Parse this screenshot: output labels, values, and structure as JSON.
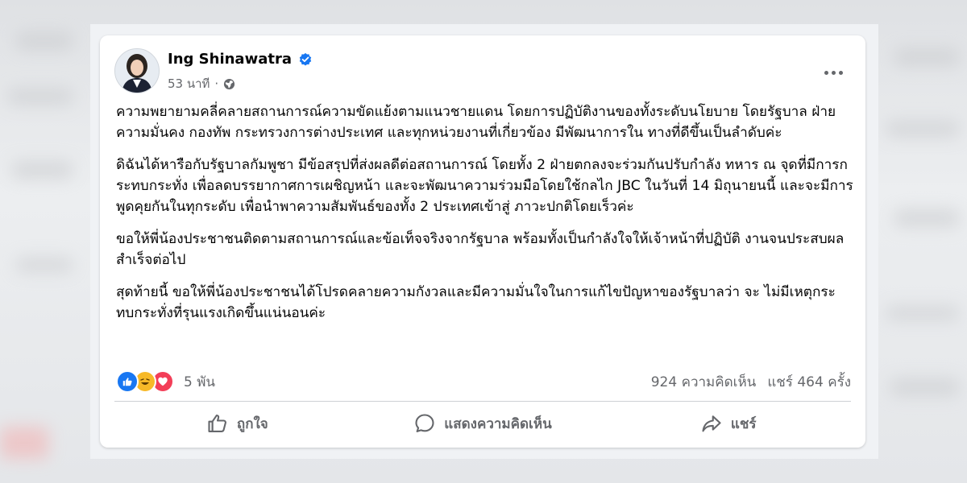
{
  "post": {
    "author": "Ing Shinawatra",
    "time": "53 นาที",
    "meta_separator": "·",
    "paragraphs": [
      "ความพยายามคลี่คลายสถานการณ์ความขัดแย้งตามแนวชายแดน โดยการปฏิบัติงานของทั้งระดับนโยบาย โดยรัฐบาล ฝ่ายความมั่นคง กองทัพ กระทรวงการต่างประเทศ และทุกหน่วยงานที่เกี่ยวข้อง มีพัฒนาการใน ทางที่ดีขึ้นเป็นลำดับค่ะ",
      "ดิฉันได้หารือกับรัฐบาลกัมพูชา มีข้อสรุปที่ส่งผลดีต่อสถานการณ์ โดยทั้ง 2 ฝ่ายตกลงจะร่วมกันปรับกำลัง ทหาร ณ จุดที่มีการกระทบกระทั่ง เพื่อลดบรรยากาศการเผชิญหน้า และจะพัฒนาความร่วมมือโดยใช้กลไก JBC ในวันที่ 14 มิถุนายนนี้ และจะมีการพูดคุยกันในทุกระดับ เพื่อนำพาความสัมพันธ์ของทั้ง 2 ประเทศเข้าสู่ ภาวะปกติโดยเร็วค่ะ",
      "ขอให้พี่น้องประชาชนติดตามสถานการณ์และข้อเท็จจริงจากรัฐบาล พร้อมทั้งเป็นกำลังใจให้เจ้าหน้าที่ปฏิบัติ งานจนประสบผลสำเร็จต่อไป",
      "สุดท้ายนี้ ขอให้พี่น้องประชาชนได้โปรดคลายความกังวลและมีความมั่นใจในการแก้ไขปัญหาของรัฐบาลว่า จะ ไม่มีเหตุกระทบกระทั่งที่รุนแรงเกิดขึ้นแน่นอนค่ะ"
    ],
    "reactions_count": "5 พัน",
    "comments_count": "924 ความคิดเห็น",
    "shares_count": "แชร์ 464 ครั้ง"
  },
  "actions": {
    "like": "ถูกใจ",
    "comment": "แสดงความคิดเห็น",
    "share": "แชร์"
  },
  "colors": {
    "verified": "#1877f2",
    "like": "#1877f2",
    "haha": "#f7b928",
    "love": "#f33e58",
    "text": "#050505",
    "secondary": "#65676b"
  },
  "icons": {
    "verified": "verified-badge-icon",
    "privacy": "globe-icon",
    "more": "more-options-icon",
    "like": "thumbs-up-icon",
    "comment": "comment-bubble-icon",
    "share": "share-arrow-icon"
  }
}
